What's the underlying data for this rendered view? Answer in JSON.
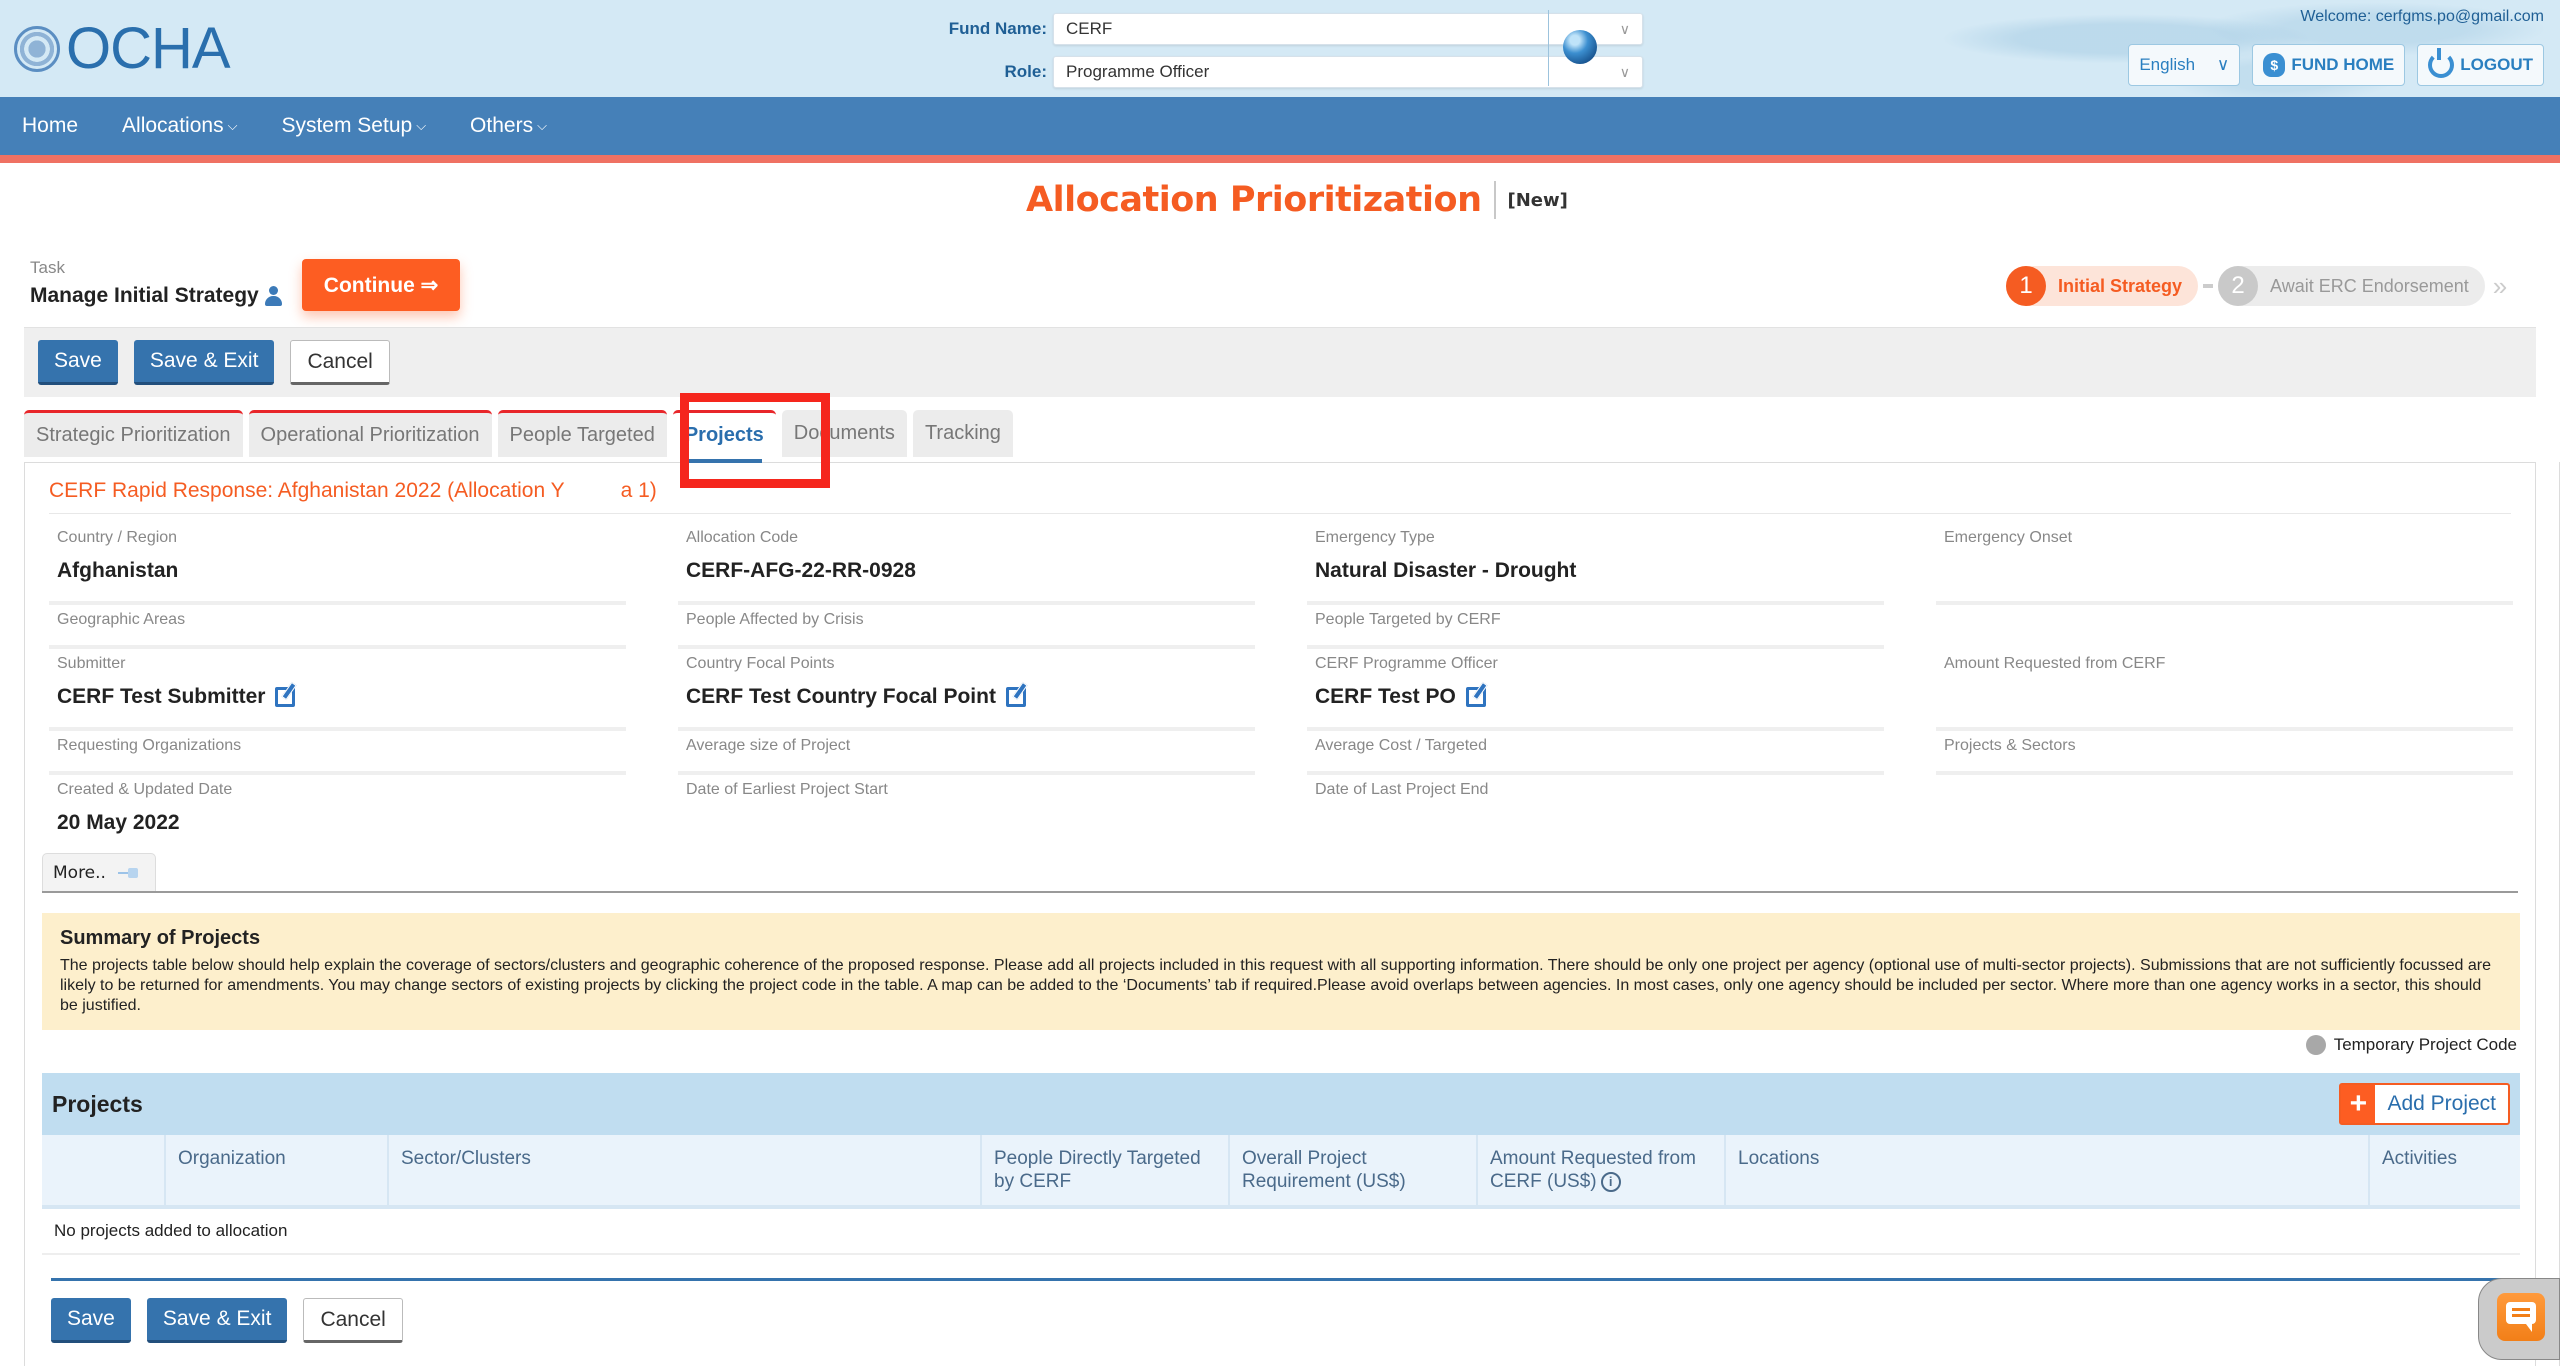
{
  "header": {
    "logo_text": "OCHA",
    "fund_name_label": "Fund Name:",
    "fund_name_value": "CERF",
    "role_label": "Role:",
    "role_value": "Programme Officer",
    "welcome_text": "Welcome: cerfgms.po@gmail.com",
    "language_value": "English",
    "fund_home_label": "FUND HOME",
    "logout_label": "LOGOUT"
  },
  "nav": {
    "items": [
      {
        "label": "Home",
        "has_dropdown": false
      },
      {
        "label": "Allocations",
        "has_dropdown": true
      },
      {
        "label": "System Setup",
        "has_dropdown": true
      },
      {
        "label": "Others",
        "has_dropdown": true
      }
    ]
  },
  "page": {
    "title": "Allocation Prioritization",
    "status": "[New]"
  },
  "task": {
    "label": "Task",
    "name": "Manage Initial Strategy",
    "continue_label": "Continue ⇒"
  },
  "stepper": {
    "steps": [
      {
        "number": "1",
        "label": "Initial Strategy",
        "state": "active"
      },
      {
        "number": "2",
        "label": "Await ERC Endorsement",
        "state": "pending"
      }
    ]
  },
  "actions": {
    "save_label": "Save",
    "save_exit_label": "Save & Exit",
    "cancel_label": "Cancel"
  },
  "tabs": [
    {
      "label": "Strategic Prioritization",
      "flagged": true,
      "active": false
    },
    {
      "label": "Operational Prioritization",
      "flagged": true,
      "active": false
    },
    {
      "label": "People Targeted",
      "flagged": true,
      "active": false
    },
    {
      "label": "Projects",
      "flagged": true,
      "active": true
    },
    {
      "label": "Documents",
      "flagged": false,
      "active": false
    },
    {
      "label": "Tracking",
      "flagged": false,
      "active": false
    }
  ],
  "allocation": {
    "title_part1": "CERF Rapid Response: Afghanistan 2022 (Allocation Y",
    "title_part2": "a 1)",
    "fields": {
      "country_region": {
        "label": "Country / Region",
        "value": "Afghanistan"
      },
      "allocation_code": {
        "label": "Allocation Code",
        "value": "CERF-AFG-22-RR-0928"
      },
      "emergency_type": {
        "label": "Emergency Type",
        "value": "Natural Disaster - Drought"
      },
      "emergency_onset": {
        "label": "Emergency Onset",
        "value": ""
      },
      "geographic_areas": {
        "label": "Geographic Areas",
        "value": ""
      },
      "people_affected": {
        "label": "People Affected by Crisis",
        "value": ""
      },
      "people_targeted": {
        "label": "People Targeted by CERF",
        "value": ""
      },
      "submitter": {
        "label": "Submitter",
        "value": "CERF Test Submitter"
      },
      "country_focal_points": {
        "label": "Country Focal Points",
        "value": "CERF Test Country Focal Point"
      },
      "programme_officer": {
        "label": "CERF Programme Officer",
        "value": "CERF Test PO"
      },
      "amount_requested": {
        "label": "Amount Requested from CERF",
        "value": ""
      },
      "requesting_orgs": {
        "label": "Requesting Organizations",
        "value": ""
      },
      "avg_size_project": {
        "label": "Average size of Project",
        "value": ""
      },
      "avg_cost_targeted": {
        "label": "Average Cost / Targeted",
        "value": ""
      },
      "projects_sectors": {
        "label": "Projects & Sectors",
        "value": ""
      },
      "created_updated": {
        "label": "Created & Updated Date",
        "value": "20 May 2022"
      },
      "earliest_start": {
        "label": "Date of Earliest Project Start",
        "value": ""
      },
      "last_end": {
        "label": "Date of Last Project End",
        "value": ""
      }
    },
    "more_label": "More.."
  },
  "summary": {
    "title": "Summary of Projects",
    "text": "The projects table below should help explain the coverage of sectors/clusters and geographic coherence of the proposed response. Please add all projects included in this request with all supporting information. There should be only one project per agency (optional use of multi-sector projects). Submissions that are not sufficiently focussed are likely to be returned for amendments. You may change sectors of existing projects by clicking the project code in the table. A map can be added to the ‘Documents’ tab if required.Please avoid overlaps between agencies. In most cases, only one agency should be included per sector. Where more than one agency works in a sector, this should be justified.",
    "legend_label": "Temporary Project Code"
  },
  "projects": {
    "title": "Projects",
    "add_label": "Add Project",
    "columns": [
      "",
      "Organization",
      "Sector/Clusters",
      "People Directly Targeted by CERF",
      "Overall Project Requirement (US$)",
      "Amount Requested from CERF (US$)",
      "Locations",
      "Activities"
    ],
    "empty_message": "No projects added to allocation"
  },
  "colors": {
    "brand_orange": "#f55c22",
    "nav_blue": "#4580b8",
    "primary_button": "#3573ad",
    "header_bg": "#d4e9f5",
    "accent_line": "#ef7163",
    "summary_bg": "#fdefcc",
    "highlight_red": "#f5261d"
  }
}
